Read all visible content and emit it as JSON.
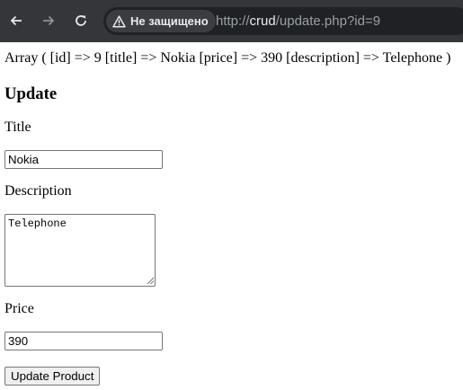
{
  "browser": {
    "security_label": "Не защищено",
    "url_prefix": "http://",
    "url_host": "crud",
    "url_path": "/update.php?id=9",
    "icons": [
      "back-arrow-icon",
      "forward-arrow-icon",
      "reload-icon",
      "warning-triangle-icon"
    ]
  },
  "page": {
    "debug_output": "Array ( [id] => 9 [title] => Nokia [price] => 390 [description] => Telephone )",
    "heading": "Update",
    "form": {
      "title_label": "Title",
      "title_value": "Nokia",
      "description_label": "Description",
      "description_value": "Telephone",
      "price_label": "Price",
      "price_value": "390",
      "submit_label": "Update Product"
    }
  }
}
